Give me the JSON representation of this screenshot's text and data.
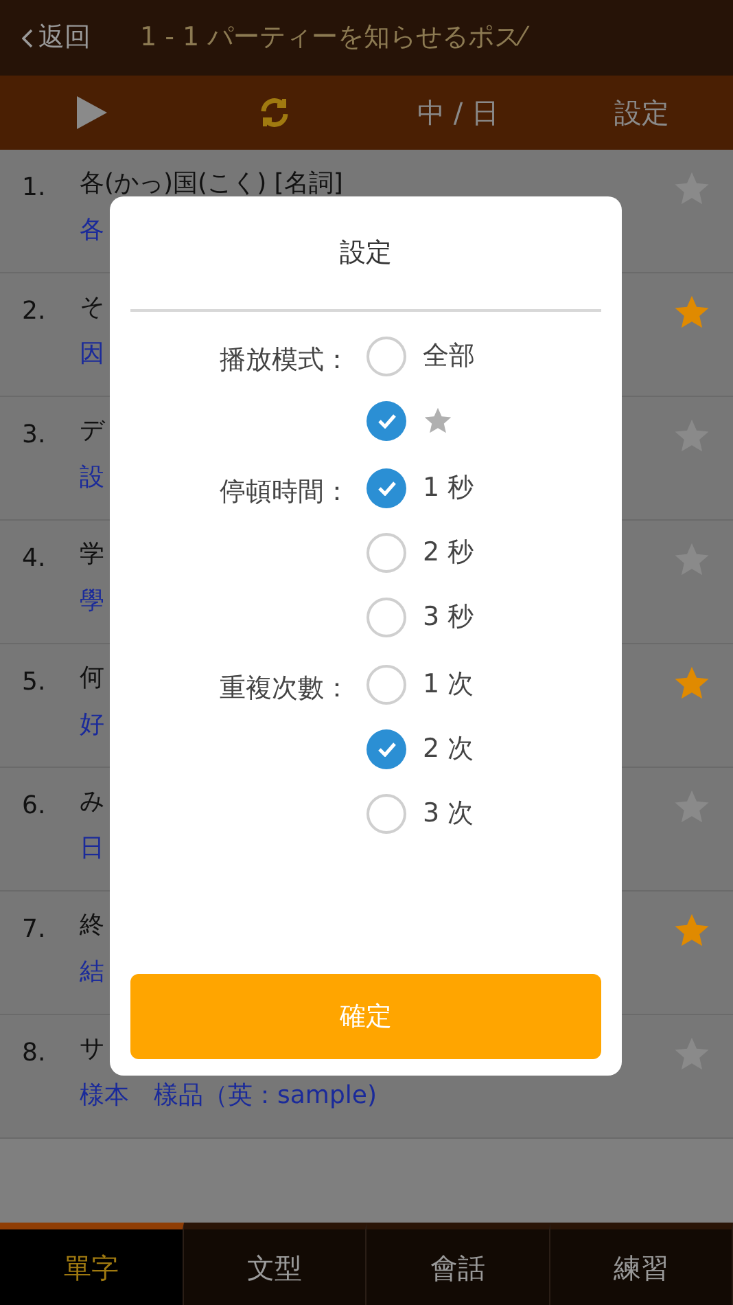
{
  "header": {
    "back": "返回",
    "title": "1 - 1 パーティーを知らせるポス⁄"
  },
  "toolbar": {
    "language": "中 / 日",
    "settings": "設定"
  },
  "list": [
    {
      "number": "1.",
      "word": "各(かっ)国(こく) [名詞]",
      "meaning": "各",
      "starred": false
    },
    {
      "number": "2.",
      "word": "そ",
      "meaning": "因",
      "starred": true
    },
    {
      "number": "3.",
      "word": "デ",
      "meaning": "設",
      "starred": false
    },
    {
      "number": "4.",
      "word": "学",
      "meaning": "學",
      "starred": false
    },
    {
      "number": "5.",
      "word": "何",
      "meaning": "好",
      "starred": true
    },
    {
      "number": "6.",
      "word": "み",
      "meaning": "日",
      "starred": false
    },
    {
      "number": "7.",
      "word": "終",
      "meaning": "結",
      "starred": true
    },
    {
      "number": "8.",
      "word": "サ",
      "meaning": "様本　樣品（英：sample)",
      "starred": false
    }
  ],
  "dialog": {
    "title": "設定",
    "groups": [
      {
        "label": "播放模式：",
        "options": [
          {
            "kind": "text",
            "label": "全部",
            "selected": false
          },
          {
            "kind": "star",
            "selected": true
          }
        ]
      },
      {
        "label": "停頓時間：",
        "options": [
          {
            "kind": "text",
            "label": "1 秒",
            "selected": true
          },
          {
            "kind": "text",
            "label": "2 秒",
            "selected": false
          },
          {
            "kind": "text",
            "label": "3 秒",
            "selected": false
          }
        ]
      },
      {
        "label": "重複次數：",
        "options": [
          {
            "kind": "text",
            "label": "1 次",
            "selected": false
          },
          {
            "kind": "text",
            "label": "2 次",
            "selected": true
          },
          {
            "kind": "text",
            "label": "3 次",
            "selected": false
          }
        ]
      }
    ],
    "confirm": "確定"
  },
  "tabs": [
    {
      "label": "單字",
      "selected": true
    },
    {
      "label": "文型",
      "selected": false
    },
    {
      "label": "會話",
      "selected": false
    },
    {
      "label": "練習",
      "selected": false
    }
  ]
}
